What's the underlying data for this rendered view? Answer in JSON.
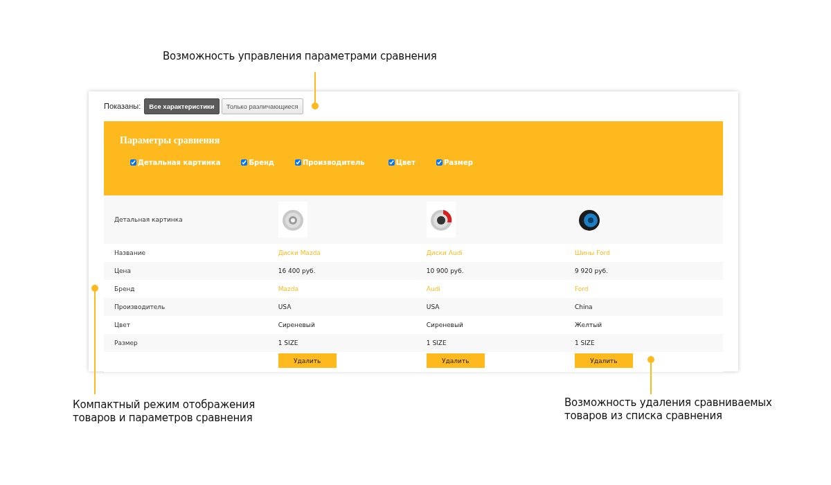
{
  "callouts": [
    {
      "kind": "top",
      "text": "Возможность управления параметрами сравнения"
    },
    {
      "kind": "bottom-left",
      "text": "Компактный режим отображения\nтоваров и параметров сравнения"
    },
    {
      "kind": "bottom-right",
      "text": "Возможность удаления сравниваемых\nтоваров из списка сравнения"
    }
  ],
  "filter": {
    "label": "Показаны:",
    "options": [
      {
        "label": "Все характеристики",
        "selected": true
      },
      {
        "label": "Только различающиеся",
        "selected": false
      }
    ]
  },
  "params_panel": {
    "title": "Параметры сравнения",
    "params": [
      {
        "label": "Детальная картинка",
        "checked": true
      },
      {
        "label": "Бренд",
        "checked": true
      },
      {
        "label": "Производитель",
        "checked": true
      },
      {
        "label": "Цвет",
        "checked": true
      },
      {
        "label": "Размер",
        "checked": true
      }
    ]
  },
  "rows": [
    {
      "label": "Детальная картинка"
    },
    {
      "label": "Название",
      "cells": [
        {
          "kind": "link",
          "text": "Диски Mazda"
        },
        {
          "kind": "link",
          "text": "Диски Audi"
        },
        {
          "kind": "link",
          "text": "Шины Ford"
        }
      ]
    },
    {
      "label": "Цена",
      "cells": [
        {
          "kind": "text",
          "text": "16 400 руб."
        },
        {
          "kind": "text",
          "text": "10 900 руб."
        },
        {
          "kind": "text",
          "text": "9 920 руб."
        }
      ]
    },
    {
      "label": "Бренд",
      "cells": [
        {
          "kind": "link",
          "text": "Mazda"
        },
        {
          "kind": "link",
          "text": "Audi"
        },
        {
          "kind": "link",
          "text": "Ford"
        }
      ]
    },
    {
      "label": "Производитель",
      "cells": [
        {
          "kind": "text",
          "text": "USA"
        },
        {
          "kind": "text",
          "text": "USA"
        },
        {
          "kind": "text",
          "text": "China"
        }
      ]
    },
    {
      "label": "Цвет",
      "cells": [
        {
          "kind": "text",
          "text": "Сиреневый"
        },
        {
          "kind": "text",
          "text": "Сиреневый"
        },
        {
          "kind": "text",
          "text": "Желтый"
        }
      ]
    },
    {
      "label": "Размер",
      "cells": [
        {
          "kind": "text",
          "text": "1 SIZE"
        },
        {
          "kind": "text",
          "text": "1 SIZE"
        },
        {
          "kind": "text",
          "text": "1 SIZE"
        }
      ]
    }
  ],
  "remove_buttons": [
    "Удалить",
    "Удалить",
    "Удалить"
  ]
}
